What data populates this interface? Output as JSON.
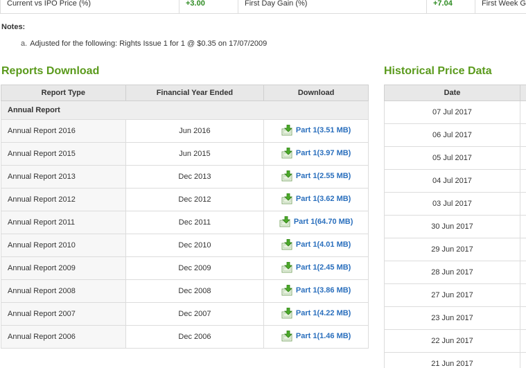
{
  "stats": {
    "current_vs_ipo_label": "Current vs IPO Price (%)",
    "current_vs_ipo_value": "+3.00",
    "first_day_gain_label": "First Day Gain (%)",
    "first_day_gain_value": "+7.04",
    "first_week_label": "First Week G"
  },
  "notes": {
    "title": "Notes:",
    "items": [
      {
        "marker": "a.",
        "text": "Adjusted for the following: Rights Issue 1 for 1 @ $0.35 on 17/07/2009"
      }
    ]
  },
  "reports": {
    "title": "Reports Download",
    "headers": [
      "Report Type",
      "Financial Year Ended",
      "Download"
    ],
    "group": "Annual Report",
    "rows": [
      {
        "type": "Annual Report 2016",
        "fy": "Jun 2016",
        "link": "Part 1(3.51 MB)"
      },
      {
        "type": "Annual Report 2015",
        "fy": "Jun 2015",
        "link": "Part 1(3.97 MB)"
      },
      {
        "type": "Annual Report 2013",
        "fy": "Dec 2013",
        "link": "Part 1(2.55 MB)"
      },
      {
        "type": "Annual Report 2012",
        "fy": "Dec 2012",
        "link": "Part 1(3.62 MB)"
      },
      {
        "type": "Annual Report 2011",
        "fy": "Dec 2011",
        "link": "Part 1(64.70 MB)"
      },
      {
        "type": "Annual Report 2010",
        "fy": "Dec 2010",
        "link": "Part 1(4.01 MB)"
      },
      {
        "type": "Annual Report 2009",
        "fy": "Dec 2009",
        "link": "Part 1(2.45 MB)"
      },
      {
        "type": "Annual Report 2008",
        "fy": "Dec 2008",
        "link": "Part 1(3.86 MB)"
      },
      {
        "type": "Annual Report 2007",
        "fy": "Dec 2007",
        "link": "Part 1(4.22 MB)"
      },
      {
        "type": "Annual Report 2006",
        "fy": "Dec 2006",
        "link": "Part 1(1.46 MB)"
      }
    ]
  },
  "historical": {
    "title": "Historical Price Data",
    "header_date": "Date",
    "dates": [
      "07 Jul 2017",
      "06 Jul 2017",
      "05 Jul 2017",
      "04 Jul 2017",
      "03 Jul 2017",
      "30 Jun 2017",
      "29 Jun 2017",
      "28 Jun 2017",
      "27 Jun 2017",
      "23 Jun 2017",
      "22 Jun 2017",
      "21 Jun 2017"
    ]
  },
  "icons": {
    "download": "download-arrow-icon"
  },
  "colors": {
    "section_title": "#5a9a1c",
    "link": "#2a6fbd",
    "positive_value": "#2e8b22"
  }
}
